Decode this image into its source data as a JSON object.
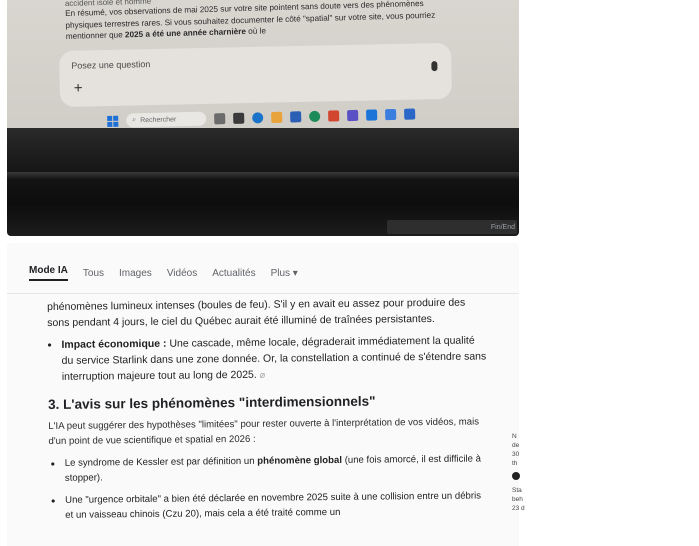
{
  "top_photo": {
    "chat_faded_line": "accident isolé et homme",
    "chat_paragraph_parts": [
      "En résumé, vos observations de mai 2025 sur votre site pointent sans doute vers des phénomènes physiques terrestres rares. Si vous souhaitez documenter le côté \"spatial\" sur votre site, vous pourriez mentionner que ",
      "2025 a été une année charnière",
      " où le"
    ],
    "ask_placeholder": "Posez une question",
    "plus_icon": "+",
    "taskbar_search": "Rechercher",
    "key_label": "Fin/End"
  },
  "bottom_photo": {
    "tabs": [
      "Mode IA",
      "Tous",
      "Images",
      "Vidéos",
      "Actualités",
      "Plus ▾"
    ],
    "intro_paragraph": "phénomènes lumineux intenses (boules de feu). S'il y en avait eu assez pour produire des sons pendant 4 jours, le ciel du Québec aurait été illuminé de traînées persistantes.",
    "bullet1_label": "Impact économique :",
    "bullet1_text": " Une cascade, même locale, dégraderait immédiatement la qualité du service Starlink dans une zone donnée. Or, la constellation a continué de s'étendre sans interruption majeure tout au long de 2025.",
    "section_title": "3. L'avis sur les phénomènes \"interdimensionnels\"",
    "section_paragraph": "L'IA peut suggérer des hypothèses \"limitées\" pour rester ouverte à l'interprétation de vos vidéos, mais d'un point de vue scientifique et spatial en 2026 :",
    "bullet2_text_before": "Le syndrome de Kessler est par définition un ",
    "bullet2_bold": "phénomène global",
    "bullet2_text_after": " (une fois amorcé, il est difficile à stopper).",
    "bullet3_text": "Une \"urgence orbitale\" a bien été déclarée en novembre 2025 suite à une collision entre un débris et un vaisseau chinois (Czu 20), mais cela a été traité comme un",
    "right_margin_text": [
      "N",
      "de",
      "30",
      "th",
      "Sta",
      "beh",
      "23 d"
    ]
  }
}
